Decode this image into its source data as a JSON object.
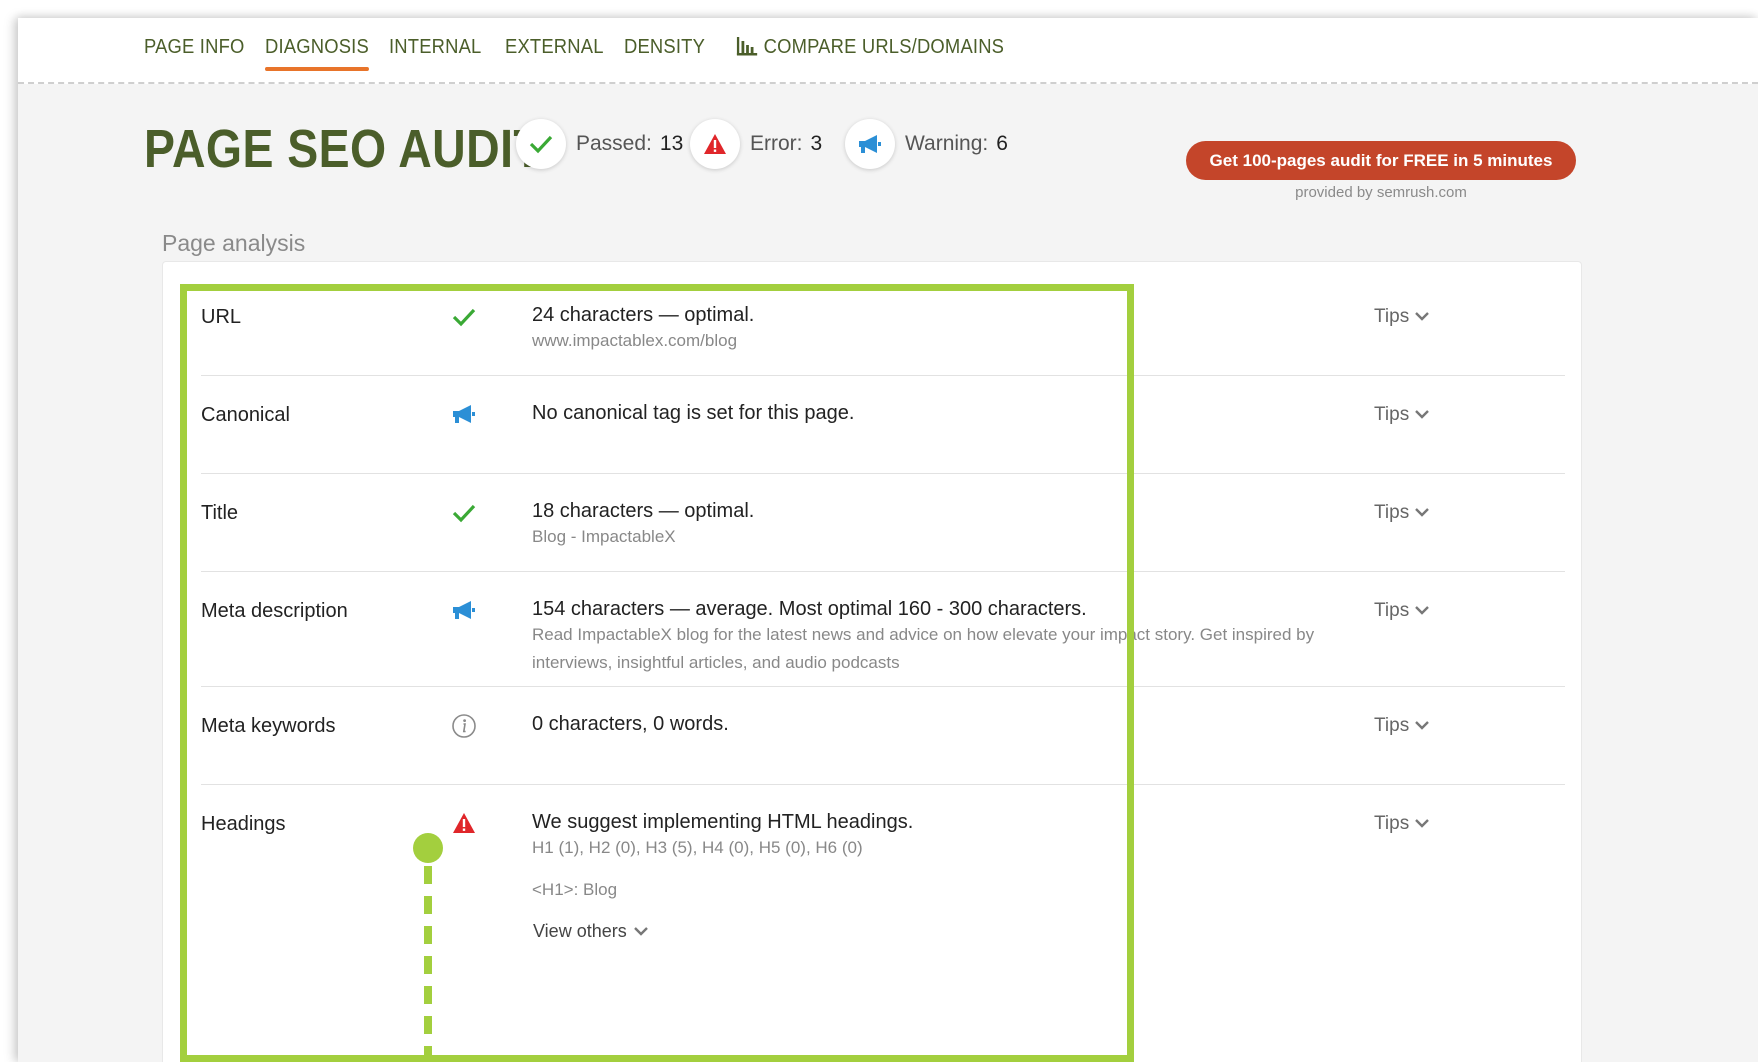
{
  "nav": {
    "tabs": [
      {
        "label": "PAGE INFO"
      },
      {
        "label": "DIAGNOSIS",
        "active": true
      },
      {
        "label": "INTERNAL"
      },
      {
        "label": "EXTERNAL"
      },
      {
        "label": "DENSITY"
      },
      {
        "label": "COMPARE URLS/DOMAINS",
        "icon": "bar-chart-icon"
      }
    ]
  },
  "header": {
    "title": "PAGE SEO AUDIT",
    "passed_label": "Passed:",
    "passed_value": "13",
    "error_label": "Error:",
    "error_value": "3",
    "warning_label": "Warning:",
    "warning_value": "6",
    "cta_label": "Get 100-pages audit for FREE in 5 minutes",
    "provided_by": "provided by  semrush.com"
  },
  "section": {
    "label": "Page analysis"
  },
  "rows": [
    {
      "label": "URL",
      "status": "check-icon",
      "main": "24 characters — optimal.",
      "sub": "www.impactablex.com/blog",
      "tips": "Tips"
    },
    {
      "label": "Canonical",
      "status": "megaphone-icon",
      "main": "No canonical tag is set for this page.",
      "sub": "",
      "tips": "Tips"
    },
    {
      "label": "Title",
      "status": "check-icon",
      "main": "18 characters — optimal.",
      "sub": "Blog - ImpactableX",
      "tips": "Tips"
    },
    {
      "label": "Meta description",
      "status": "megaphone-icon",
      "main": "154 characters — average. Most optimal 160 - 300 characters.",
      "sub": "Read ImpactableX blog for the latest news and advice on how elevate your impact story. Get inspired by interviews, insightful articles, and audio podcasts",
      "tips": "Tips"
    },
    {
      "label": "Meta keywords",
      "status": "info-icon",
      "main": "0 characters, 0 words.",
      "sub": "",
      "tips": "Tips"
    },
    {
      "label": "Headings",
      "status": "error-icon",
      "main": "We suggest implementing HTML headings.",
      "sub": "H1 (1), H2 (0), H3 (5), H4 (0), H5 (0), H6 (0)",
      "extra": "<H1>: Blog",
      "view_others": "View others",
      "tips": "Tips"
    }
  ],
  "colors": {
    "brand_green": "#4b5e2a",
    "accent_orange": "#e8742a",
    "cta_red": "#c4452a",
    "pass_green": "#3aa935",
    "warning_blue": "#2b8fd6",
    "error_red": "#e0262a",
    "highlight_green": "#a3cf3e"
  }
}
